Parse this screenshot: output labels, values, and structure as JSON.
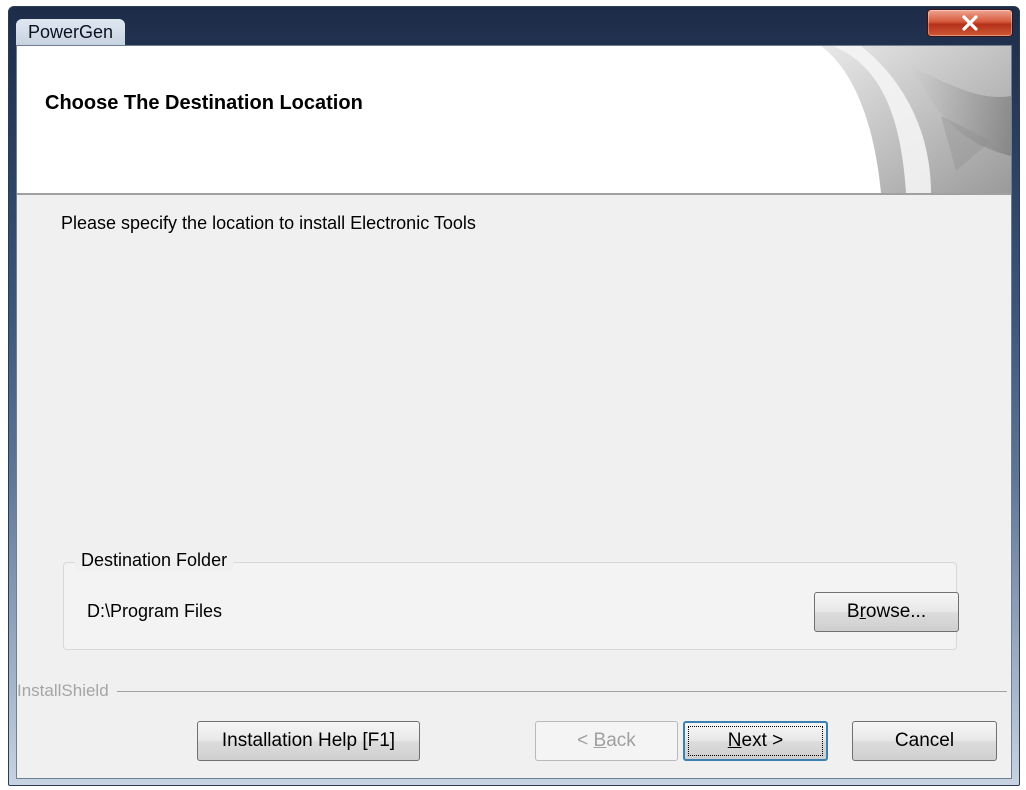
{
  "window": {
    "title": "PowerGen"
  },
  "header": {
    "title": "Choose The Destination Location"
  },
  "main": {
    "instruction": "Please specify the location to install Electronic Tools"
  },
  "destination": {
    "group_label": "Destination Folder",
    "path": "D:\\Program Files",
    "browse": {
      "before": "B",
      "mnemonic": "r",
      "after": "owse..."
    }
  },
  "footer": {
    "brand": "InstallShield",
    "help_label": "Installation Help [F1]",
    "back": {
      "prefix": "< ",
      "mnemonic": "B",
      "rest": "ack"
    },
    "next": {
      "mnemonic": "N",
      "rest": "ext >"
    },
    "cancel_label": "Cancel"
  },
  "colors": {
    "client_bg": "#f0f0f0",
    "close_button": "#c94a2a",
    "focus_border": "#3c7fb1"
  },
  "icons": {
    "close": "close-icon",
    "header_graphic": "page-curl-graphic"
  }
}
